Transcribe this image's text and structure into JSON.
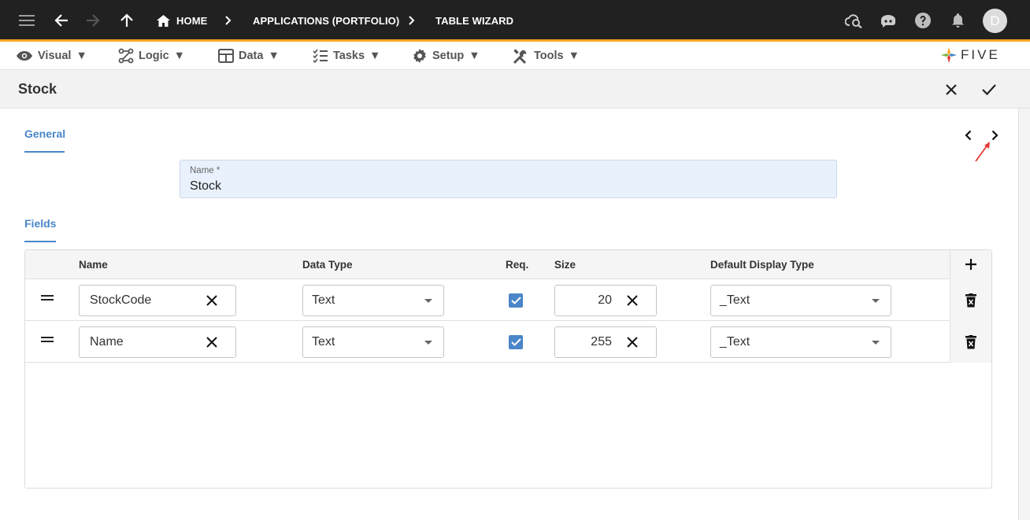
{
  "topbar": {
    "breadcrumbs": [
      "HOME",
      "APPLICATIONS (PORTFOLIO)",
      "TABLE WIZARD"
    ],
    "avatar_initial": "D"
  },
  "menubar": {
    "items": [
      {
        "label": "Visual",
        "icon": "eye-icon"
      },
      {
        "label": "Logic",
        "icon": "logic-flow-icon"
      },
      {
        "label": "Data",
        "icon": "table-grid-icon"
      },
      {
        "label": "Tasks",
        "icon": "checklist-icon"
      },
      {
        "label": "Setup",
        "icon": "gear-icon"
      },
      {
        "label": "Tools",
        "icon": "tools-icon"
      }
    ],
    "brand": "FIVE"
  },
  "titlebar": {
    "title": "Stock"
  },
  "tabs": {
    "general": "General",
    "fields": "Fields"
  },
  "name_field": {
    "label": "Name *",
    "value": "Stock"
  },
  "grid": {
    "columns": [
      "Name",
      "Data Type",
      "Req.",
      "Size",
      "Default Display Type"
    ],
    "rows": [
      {
        "name": "StockCode",
        "data_type": "Text",
        "required": true,
        "size": "20",
        "display_type": "_Text"
      },
      {
        "name": "Name",
        "data_type": "Text",
        "required": true,
        "size": "255",
        "display_type": "_Text"
      }
    ]
  },
  "colors": {
    "topbar_bg": "#212121",
    "accent_orange": "#f7a823",
    "accent_blue": "#4a86c8",
    "annotation_red": "#e53935"
  }
}
